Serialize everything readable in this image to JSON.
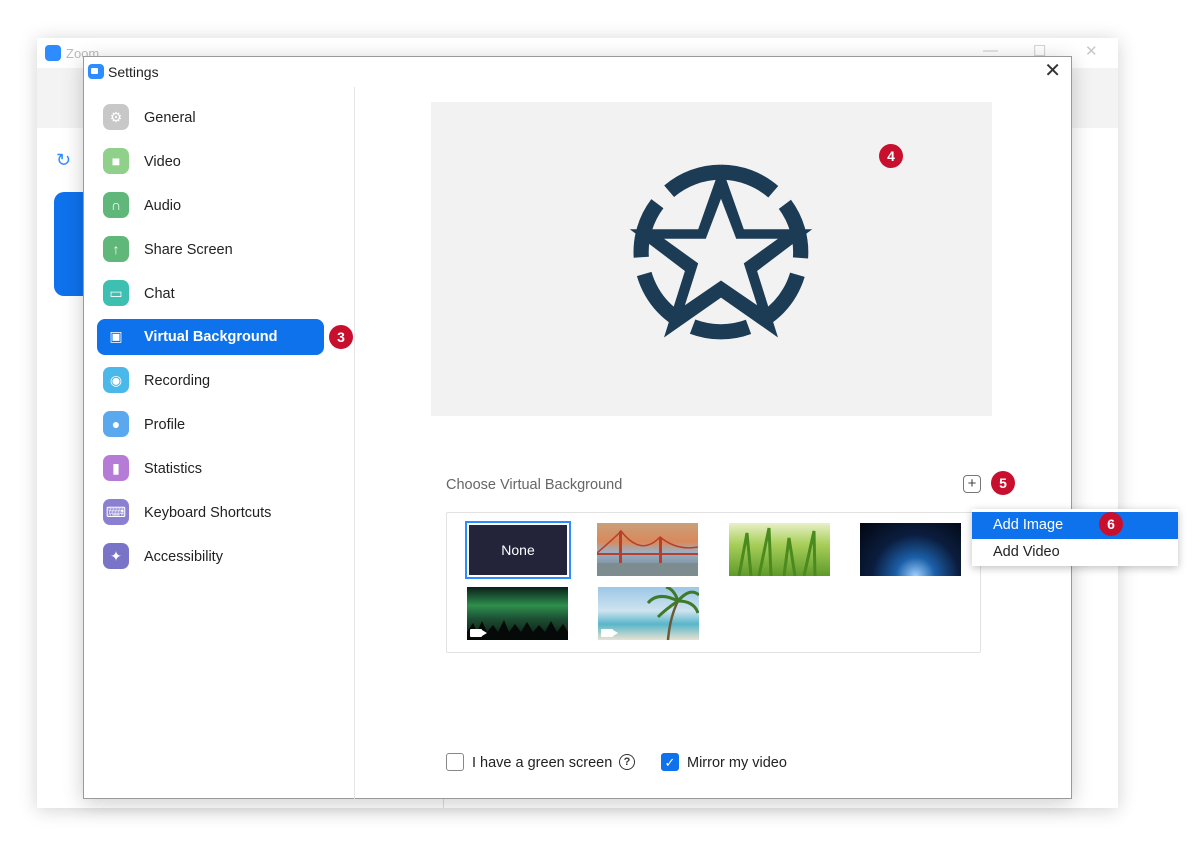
{
  "background_window": {
    "title": "Zoom",
    "minimize_glyph": "—",
    "maximize_glyph": "☐",
    "close_glyph": "✕",
    "refresh_glyph": "↻"
  },
  "dialog": {
    "title": "Settings",
    "close_glyph": "✕"
  },
  "sidebar": {
    "items": [
      {
        "label": "General",
        "icon": "gear-icon",
        "glyph": "⚙",
        "color": "#c8c8c8"
      },
      {
        "label": "Video",
        "icon": "video-camera-icon",
        "glyph": "■",
        "color": "#8fd18a"
      },
      {
        "label": "Audio",
        "icon": "headphones-icon",
        "glyph": "∩",
        "color": "#5fb879"
      },
      {
        "label": "Share Screen",
        "icon": "share-screen-icon",
        "glyph": "↑",
        "color": "#5fb879"
      },
      {
        "label": "Chat",
        "icon": "chat-icon",
        "glyph": "▭",
        "color": "#3dbfb2"
      },
      {
        "label": "Virtual Background",
        "icon": "virtual-background-icon",
        "glyph": "▣",
        "color": "#ffffff"
      },
      {
        "label": "Recording",
        "icon": "recording-icon",
        "glyph": "◉",
        "color": "#4ab8e8"
      },
      {
        "label": "Profile",
        "icon": "profile-icon",
        "glyph": "●",
        "color": "#5aa9ef"
      },
      {
        "label": "Statistics",
        "icon": "statistics-icon",
        "glyph": "▮",
        "color": "#b57bd6"
      },
      {
        "label": "Keyboard Shortcuts",
        "icon": "keyboard-icon",
        "glyph": "⌨",
        "color": "#8a7fd1"
      },
      {
        "label": "Accessibility",
        "icon": "accessibility-icon",
        "glyph": "✦",
        "color": "#7a74c9"
      }
    ],
    "active_index": 5
  },
  "annotations": {
    "step3": "3",
    "step4": "4",
    "step5": "5",
    "step6": "6",
    "color": "#c8102e"
  },
  "content": {
    "choose_label": "Choose Virtual Background",
    "add_button_glyph": "+",
    "backgrounds": [
      {
        "name": "None",
        "label": "None",
        "selected": true
      },
      {
        "name": "golden-gate-bridge",
        "label": ""
      },
      {
        "name": "grass",
        "label": ""
      },
      {
        "name": "earth-from-space",
        "label": ""
      },
      {
        "name": "aurora",
        "label": "",
        "video": true
      },
      {
        "name": "beach-palm",
        "label": "",
        "video": true
      }
    ],
    "green_screen_label": "I have a green screen",
    "green_screen_checked": false,
    "mirror_label": "Mirror my video",
    "mirror_checked": true,
    "help_glyph": "?",
    "check_glyph": "✓"
  },
  "dropdown": {
    "items": [
      "Add Image",
      "Add Video"
    ],
    "highlighted_index": 0
  },
  "colors": {
    "accent": "#0e72ed",
    "logo_star": "#1c3b54"
  }
}
